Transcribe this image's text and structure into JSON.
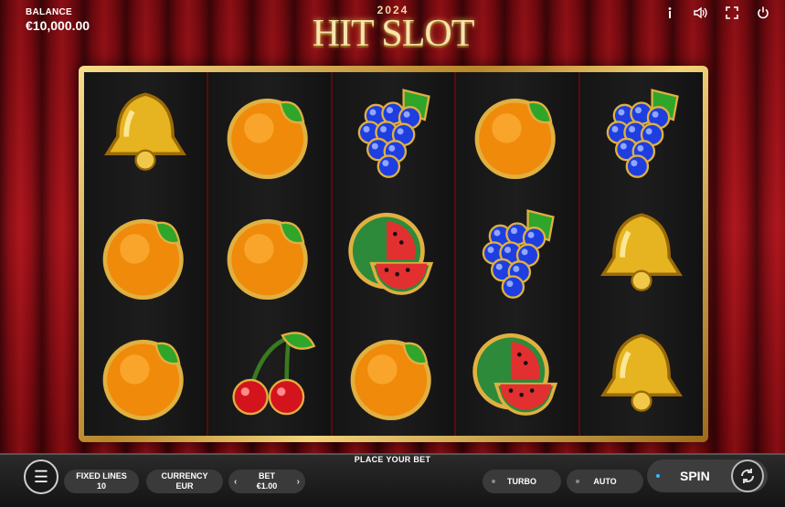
{
  "balance": {
    "label": "BALANCE",
    "value": "€10,000.00"
  },
  "logo": {
    "year": "2024",
    "title": "HIT SLOT"
  },
  "top_icons": [
    "info-icon",
    "sound-icon",
    "fullscreen-icon",
    "power-icon"
  ],
  "reels": [
    [
      "bell",
      "orange",
      "orange"
    ],
    [
      "orange",
      "orange",
      "cherry"
    ],
    [
      "grapes",
      "watermelon",
      "orange"
    ],
    [
      "orange",
      "grapes",
      "watermelon"
    ],
    [
      "grapes",
      "bell",
      "bell"
    ]
  ],
  "bottom": {
    "place_bet": "PLACE YOUR BET",
    "fixed_lines_label": "FIXED LINES",
    "fixed_lines_value": "10",
    "currency_label": "CURRENCY",
    "currency_value": "EUR",
    "bet_label": "BET",
    "bet_value": "€1.00",
    "turbo_label": "TURBO",
    "auto_label": "AUTO",
    "spin_label": "SPIN"
  },
  "colors": {
    "accent_gold": "#d9a93a",
    "curtain_red": "#a3121a",
    "active_dot": "#35b7ff"
  }
}
